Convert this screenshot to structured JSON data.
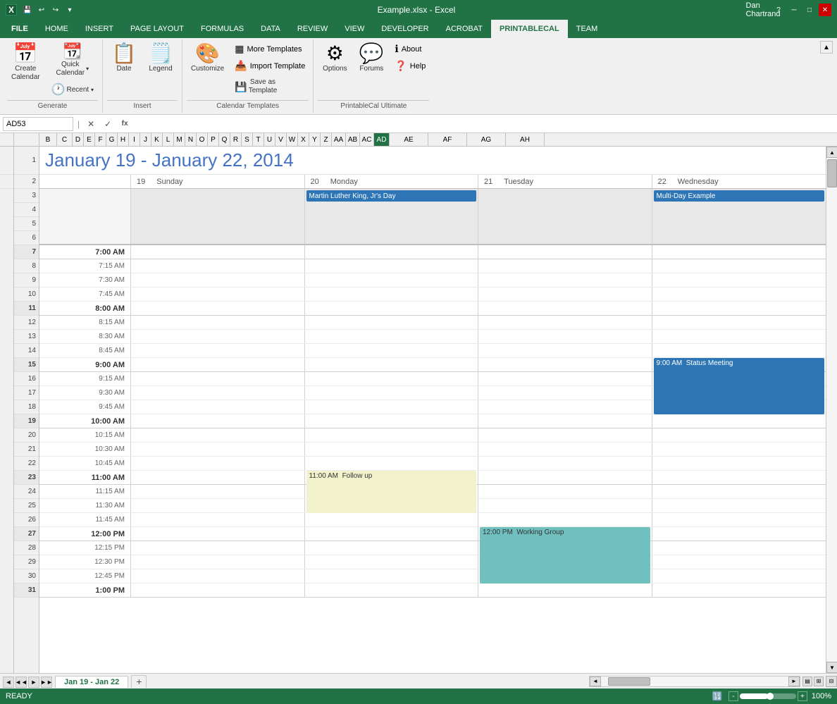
{
  "titleBar": {
    "filename": "Example.xlsx - Excel",
    "user": "Dan Chartrand"
  },
  "tabs": [
    "FILE",
    "HOME",
    "INSERT",
    "PAGE LAYOUT",
    "FORMULAS",
    "DATA",
    "REVIEW",
    "VIEW",
    "DEVELOPER",
    "ACROBAT",
    "PRINTABLECAL",
    "TEAM"
  ],
  "activeTab": "PRINTABLECAL",
  "ribbon": {
    "groups": [
      {
        "label": "Generate",
        "buttons": [
          {
            "id": "create-calendar",
            "icon": "📅",
            "label": "Create\nCalendar"
          },
          {
            "id": "quick-calendar",
            "icon": "📆",
            "label": "Quick\nCalendar",
            "hasDropdown": true
          },
          {
            "id": "recent",
            "icon": "🕐",
            "label": "Recent",
            "hasDropdown": true
          }
        ]
      },
      {
        "label": "Insert",
        "buttons": [
          {
            "id": "date",
            "icon": "📋",
            "label": "Date"
          },
          {
            "id": "legend",
            "icon": "🗒️",
            "label": "Legend"
          }
        ]
      },
      {
        "label": "Calendar Templates",
        "smallButtons": [
          {
            "id": "more-templates",
            "icon": "▦",
            "label": "More Templates"
          },
          {
            "id": "import-template",
            "icon": "📥",
            "label": "Import Template"
          },
          {
            "id": "save-as-template",
            "label": "Save as\nTemplate",
            "isMultiline": true
          }
        ],
        "hasCustomize": true
      },
      {
        "label": "PrintableCal Ultimate",
        "buttons": [
          {
            "id": "options",
            "icon": "⚙",
            "label": "Options"
          },
          {
            "id": "forums",
            "icon": "💬",
            "label": "Forums"
          }
        ],
        "smallButtons": [
          {
            "id": "about",
            "icon": "ℹ",
            "label": "About"
          },
          {
            "id": "help",
            "icon": "?",
            "label": "Help"
          }
        ]
      }
    ]
  },
  "nameBox": "AD53",
  "formulaBar": "",
  "calendarTitle": "January 19 - January 22, 2014",
  "columnHeaders": [
    "B",
    "C",
    "D",
    "E",
    "F",
    "G",
    "H",
    "I",
    "J",
    "K",
    "L",
    "M",
    "N",
    "O",
    "P",
    "Q",
    "R",
    "S",
    "T",
    "U",
    "V",
    "W",
    "X",
    "Y",
    "Z",
    "AA",
    "AB",
    "AC",
    "AD",
    "AE",
    "AF",
    "AG",
    "AH"
  ],
  "selectedCol": "AD",
  "rowHeaders": [
    "1",
    "2",
    "3",
    "4",
    "5",
    "6",
    "7",
    "8",
    "9",
    "10",
    "11",
    "12",
    "13",
    "14",
    "15",
    "16",
    "17",
    "18",
    "19",
    "20",
    "21",
    "22",
    "23",
    "24",
    "25",
    "26",
    "27",
    "28",
    "29",
    "30",
    "31"
  ],
  "dayHeaders": [
    {
      "date": "19",
      "day": "Sunday"
    },
    {
      "date": "20",
      "day": "Monday"
    },
    {
      "date": "21",
      "day": "Tuesday"
    },
    {
      "date": "22",
      "day": "Wednesday"
    }
  ],
  "timeSlots": [
    {
      "time": "",
      "bold": false
    },
    {
      "time": "",
      "bold": false
    },
    {
      "time": "7:00 AM",
      "bold": true
    },
    {
      "time": "7:15 AM",
      "bold": false
    },
    {
      "time": "7:30 AM",
      "bold": false
    },
    {
      "time": "7:45 AM",
      "bold": false
    },
    {
      "time": "8:00 AM",
      "bold": true
    },
    {
      "time": "8:15 AM",
      "bold": false
    },
    {
      "time": "8:30 AM",
      "bold": false
    },
    {
      "time": "8:45 AM",
      "bold": false
    },
    {
      "time": "9:00 AM",
      "bold": true
    },
    {
      "time": "9:15 AM",
      "bold": false
    },
    {
      "time": "9:30 AM",
      "bold": false
    },
    {
      "time": "9:45 AM",
      "bold": false
    },
    {
      "time": "10:00 AM",
      "bold": true
    },
    {
      "time": "10:15 AM",
      "bold": false
    },
    {
      "time": "10:30 AM",
      "bold": false
    },
    {
      "time": "10:45 AM",
      "bold": false
    },
    {
      "time": "11:00 AM",
      "bold": true
    },
    {
      "time": "11:15 AM",
      "bold": false
    },
    {
      "time": "11:30 AM",
      "bold": false
    },
    {
      "time": "11:45 AM",
      "bold": false
    },
    {
      "time": "12:00 PM",
      "bold": true
    },
    {
      "time": "12:15 PM",
      "bold": false
    },
    {
      "time": "12:30 PM",
      "bold": false
    },
    {
      "time": "12:45 PM",
      "bold": false
    },
    {
      "time": "1:00 PM",
      "bold": true
    }
  ],
  "events": [
    {
      "id": "mlk-day",
      "title": "Martin Luther King, Jr's Day",
      "dayIndex": 1,
      "color": "#2e75b6",
      "textColor": "white",
      "isAllDay": true
    },
    {
      "id": "multi-day",
      "title": "Multi-Day Example",
      "dayIndex": 3,
      "color": "#2e75b6",
      "textColor": "white",
      "isAllDay": true
    },
    {
      "id": "status-meeting",
      "title": "9:00 AM  Status Meeting",
      "dayIndex": 3,
      "color": "#2e75b6",
      "textColor": "white",
      "startSlot": 10,
      "endSlot": 14
    },
    {
      "id": "follow-up",
      "title": "11:00 AM  Follow up",
      "dayIndex": 1,
      "color": "#f2f2cc",
      "textColor": "#333",
      "startSlot": 18,
      "endSlot": 21
    },
    {
      "id": "working-group",
      "title": "12:00 PM  Working Group",
      "dayIndex": 2,
      "color": "#70c0c0",
      "textColor": "#333",
      "startSlot": 22,
      "endSlot": 26
    }
  ],
  "sheetTabs": [
    "Jan 19 - Jan 22"
  ],
  "statusBar": {
    "status": "READY",
    "zoom": "100%"
  }
}
